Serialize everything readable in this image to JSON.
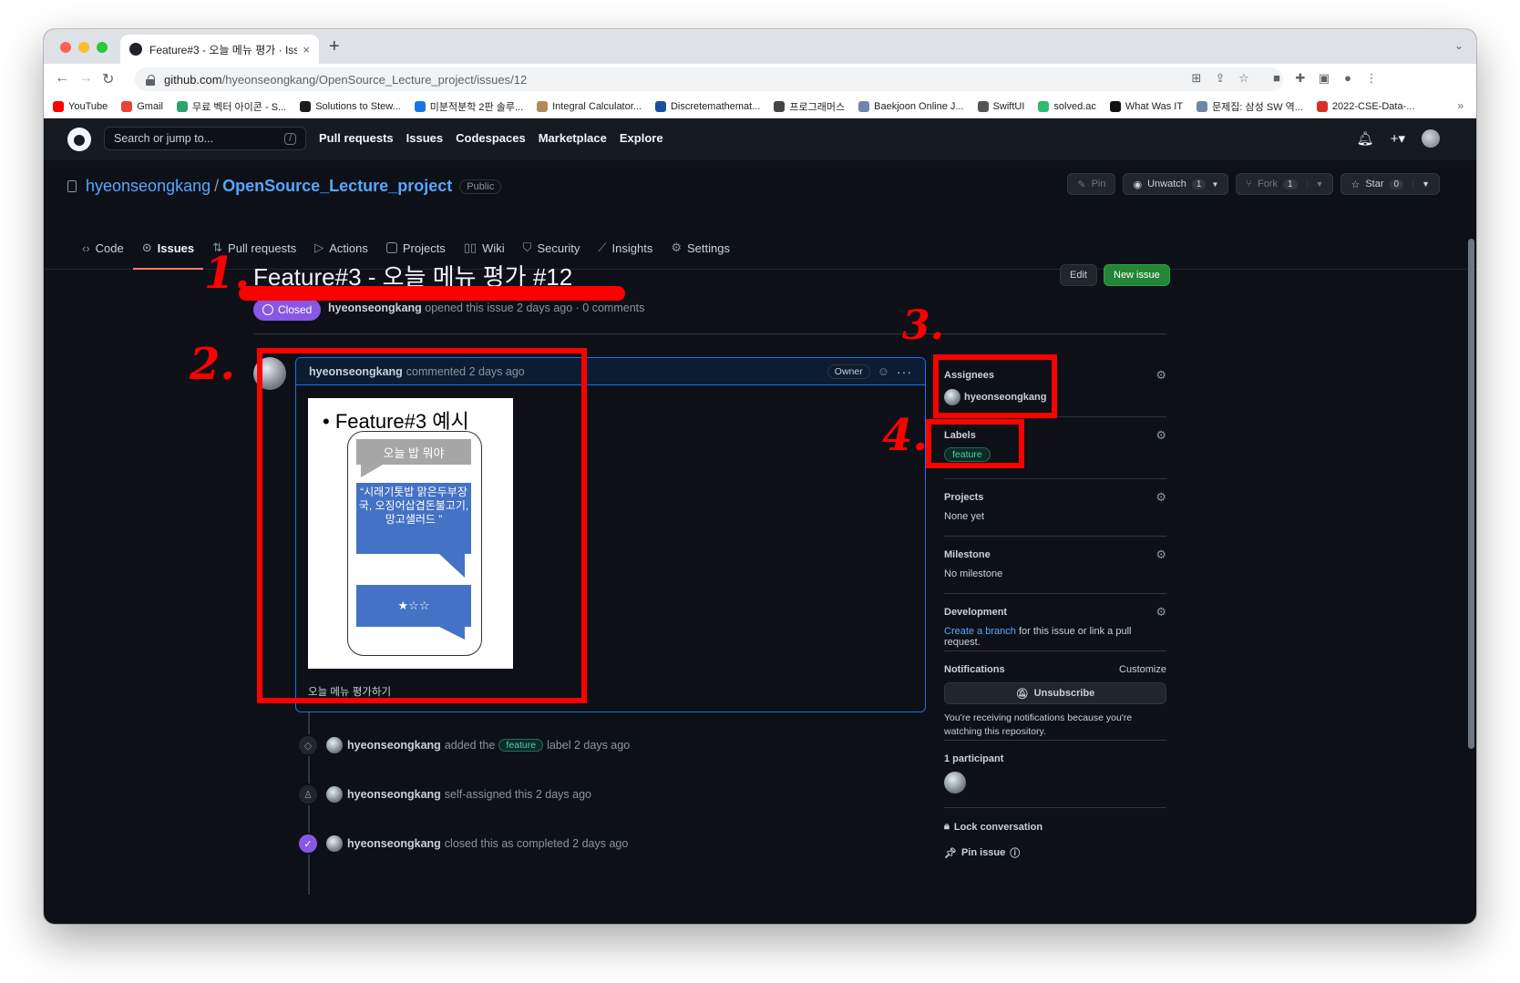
{
  "browser": {
    "tab_title": "Feature#3 - 오늘 메뉴 평가 · Issu",
    "tab_close": "×",
    "new_tab": "+",
    "url_host": "github.com",
    "url_path": "/hyeonseongkang/OpenSource_Lecture_project/issues/12",
    "bookmarks": [
      {
        "label": "YouTube",
        "color": "#ff0000"
      },
      {
        "label": "Gmail",
        "color": "#ea4335"
      },
      {
        "label": "무료 벡터 아이콘 - S...",
        "color": "#2ba36b"
      },
      {
        "label": "Solutions to Stew...",
        "color": "#1b1b1b"
      },
      {
        "label": "미분적분학 2판 솔루...",
        "color": "#1a73e8"
      },
      {
        "label": "Integral Calculator...",
        "color": "#b08a5a"
      },
      {
        "label": "Discretemathemat...",
        "color": "#1a4fa0"
      },
      {
        "label": "프로그래머스",
        "color": "#444444"
      },
      {
        "label": "Baekjoon Online J...",
        "color": "#6f86a6"
      },
      {
        "label": "SwiftUI",
        "color": "#555555"
      },
      {
        "label": "solved.ac",
        "color": "#2bbd6f"
      },
      {
        "label": "What Was IT",
        "color": "#111111"
      },
      {
        "label": "문제집: 삼성 SW 역...",
        "color": "#6f86a6"
      },
      {
        "label": "2022-CSE-Data-...",
        "color": "#d93025"
      }
    ],
    "bookmarks_more": "»"
  },
  "gh": {
    "search_placeholder": "Search or jump to...",
    "search_key": "/",
    "nav": [
      "Pull requests",
      "Issues",
      "Codespaces",
      "Marketplace",
      "Explore"
    ],
    "plus": "+▾"
  },
  "repo": {
    "owner": "hyeonseongkang",
    "sep": "/",
    "name": "OpenSource_Lecture_project",
    "visibility": "Public",
    "pin": "Pin",
    "unwatch": "Unwatch",
    "unwatch_count": "1",
    "fork": "Fork",
    "fork_count": "1",
    "star": "Star",
    "star_count": "0",
    "tabs": [
      "Code",
      "Issues",
      "Pull requests",
      "Actions",
      "Projects",
      "Wiki",
      "Security",
      "Insights",
      "Settings"
    ]
  },
  "issue": {
    "title": "Feature#3 - 오늘 메뉴 평가 #12",
    "edit": "Edit",
    "new_issue": "New issue",
    "status": "Closed",
    "author": "hyeonseongkang",
    "meta": "opened this issue 2 days ago · 0 comments"
  },
  "comment": {
    "author": "hyeonseongkang",
    "meta": "commented 2 days ago",
    "owner_badge": "Owner",
    "kebab": "···",
    "slide": {
      "title": "• Feature#3 예시",
      "gray_bubble": "오늘 밥 뭐야",
      "blue_bubble": "“시래기톳밥 맑은두부장국, 오징어삽겹돈불고기, 망고샐러드 ”",
      "stars": "★☆☆"
    },
    "caption": "오늘 메뉴 평가하기"
  },
  "timeline": [
    {
      "author": "hyeonseongkang",
      "before": "added the",
      "label": "feature",
      "after": "label 2 days ago"
    },
    {
      "author": "hyeonseongkang",
      "text": "self-assigned this 2 days ago"
    },
    {
      "author": "hyeonseongkang",
      "text": "closed this as completed 2 days ago"
    }
  ],
  "sidebar": {
    "assignees_title": "Assignees",
    "assignee": "hyeonseongkang",
    "labels_title": "Labels",
    "label": "feature",
    "projects_title": "Projects",
    "projects_value": "None yet",
    "milestone_title": "Milestone",
    "milestone_value": "No milestone",
    "development_title": "Development",
    "dev_link": "Create a branch",
    "dev_rest": "for this issue or link a pull request.",
    "notifications_title": "Notifications",
    "customize": "Customize",
    "unsubscribe": "Unsubscribe",
    "notif_text": "You're receiving notifications because you're watching this repository.",
    "participants": "1 participant",
    "lock": "Lock conversation",
    "pin_issue": "Pin issue"
  },
  "annotations": [
    "1.",
    "2.",
    "3.",
    "4."
  ],
  "colors": {
    "annotation": "#ff0000",
    "closed": "#8957e5",
    "new_issue": "#238636",
    "link": "#58a6ff"
  }
}
